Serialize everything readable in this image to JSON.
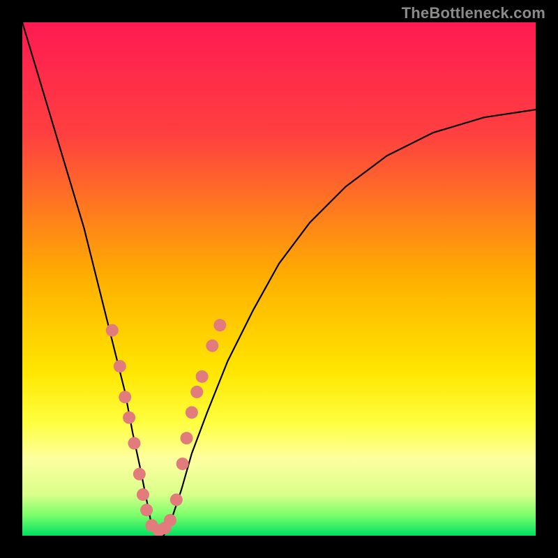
{
  "watermark": "TheBottleneck.com",
  "chart_data": {
    "type": "line",
    "title": "",
    "xlabel": "",
    "ylabel": "",
    "xlim": [
      0,
      100
    ],
    "ylim": [
      0,
      100
    ],
    "background_gradient": {
      "stops": [
        {
          "offset": 0,
          "color": "#ff1a52"
        },
        {
          "offset": 22,
          "color": "#ff4040"
        },
        {
          "offset": 50,
          "color": "#ffb000"
        },
        {
          "offset": 68,
          "color": "#ffe600"
        },
        {
          "offset": 78,
          "color": "#ffff40"
        },
        {
          "offset": 85,
          "color": "#ffffa0"
        },
        {
          "offset": 92,
          "color": "#d8ff8a"
        },
        {
          "offset": 96,
          "color": "#7bff6b"
        },
        {
          "offset": 100,
          "color": "#00e060"
        }
      ]
    },
    "series": [
      {
        "name": "bottleneck-curve",
        "color": "#000000",
        "stroke_width": 2.2,
        "x": [
          0,
          3,
          6,
          9,
          12,
          14,
          16,
          18,
          20,
          21.5,
          23,
          24,
          25,
          26,
          27.5,
          29,
          31,
          33,
          36,
          40,
          45,
          50,
          56,
          63,
          71,
          80,
          90,
          100
        ],
        "y": [
          100,
          90,
          80,
          70,
          60,
          52,
          44,
          36,
          28,
          20,
          13,
          8,
          3,
          0,
          0,
          3,
          9,
          16,
          24,
          34,
          44,
          53,
          61,
          68,
          74,
          78.5,
          81.5,
          83
        ]
      }
    ],
    "markers": {
      "name": "highlight-dots",
      "color": "#e27b7b",
      "radius": 9,
      "points": [
        {
          "x": 17.5,
          "y": 40
        },
        {
          "x": 19.0,
          "y": 33
        },
        {
          "x": 20.0,
          "y": 27
        },
        {
          "x": 20.8,
          "y": 23
        },
        {
          "x": 21.8,
          "y": 18
        },
        {
          "x": 22.8,
          "y": 12
        },
        {
          "x": 23.5,
          "y": 8
        },
        {
          "x": 24.2,
          "y": 5
        },
        {
          "x": 25.2,
          "y": 2
        },
        {
          "x": 26.6,
          "y": 1
        },
        {
          "x": 27.8,
          "y": 1.5
        },
        {
          "x": 28.8,
          "y": 3
        },
        {
          "x": 30.0,
          "y": 7
        },
        {
          "x": 31.2,
          "y": 14
        },
        {
          "x": 32.0,
          "y": 19
        },
        {
          "x": 33.0,
          "y": 24
        },
        {
          "x": 34.0,
          "y": 28
        },
        {
          "x": 35.0,
          "y": 31
        },
        {
          "x": 37.0,
          "y": 37
        },
        {
          "x": 38.5,
          "y": 41
        }
      ]
    }
  }
}
